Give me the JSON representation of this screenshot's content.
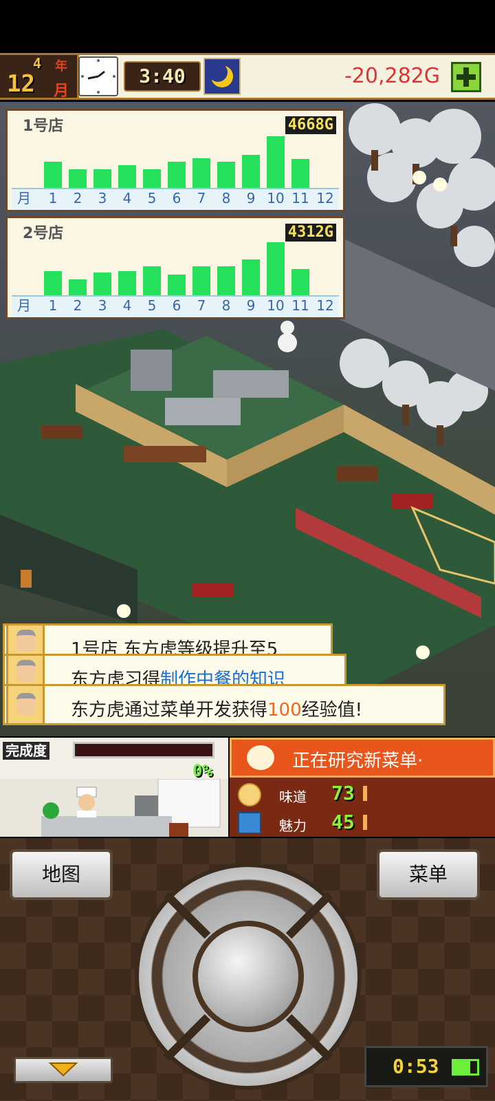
{
  "status": {
    "year_num": "4",
    "year_unit": "年",
    "month_num": "12",
    "month_unit": "月",
    "time": "3:40",
    "money": "-20,282G",
    "plus_icon": "plus-icon"
  },
  "chart_data": [
    {
      "type": "bar",
      "title": "1号店",
      "total": "4668G",
      "axis_label": "月",
      "categories": [
        "1",
        "2",
        "3",
        "4",
        "5",
        "6",
        "7",
        "8",
        "9",
        "10",
        "11",
        "12"
      ],
      "values": [
        38,
        27,
        27,
        33,
        27,
        38,
        43,
        38,
        48,
        75,
        42,
        null
      ],
      "ylim": [
        0,
        80
      ],
      "bar_color": "#25e05a"
    },
    {
      "type": "bar",
      "title": "2号店",
      "total": "4312G",
      "axis_label": "月",
      "categories": [
        "1",
        "2",
        "3",
        "4",
        "5",
        "6",
        "7",
        "8",
        "9",
        "10",
        "11",
        "12"
      ],
      "values": [
        35,
        23,
        33,
        35,
        42,
        30,
        42,
        42,
        52,
        77,
        38,
        null
      ],
      "ylim": [
        0,
        80
      ],
      "bar_color": "#25e05a"
    }
  ],
  "notifications": [
    {
      "pre": "1号店 东方虎等级提升至5",
      "hl": "",
      "post": ""
    },
    {
      "pre": "东方虎习得",
      "hl": "制作中餐的知识",
      "post": ""
    },
    {
      "pre": "东方虎通过菜单开发获得",
      "hl": "100",
      "post": "经验值!"
    }
  ],
  "kitchen": {
    "label": "完成度",
    "progress": "0%",
    "progress_fraction": 0
  },
  "research": {
    "title": "正在研究新菜单·",
    "stats": [
      {
        "label": "味道",
        "value": "73",
        "icon": "taste-icon"
      },
      {
        "label": "魅力",
        "value": "45",
        "icon": "charm-icon"
      }
    ]
  },
  "controls": {
    "map_label": "地图",
    "menu_label": "菜单",
    "timer": "0:53"
  }
}
